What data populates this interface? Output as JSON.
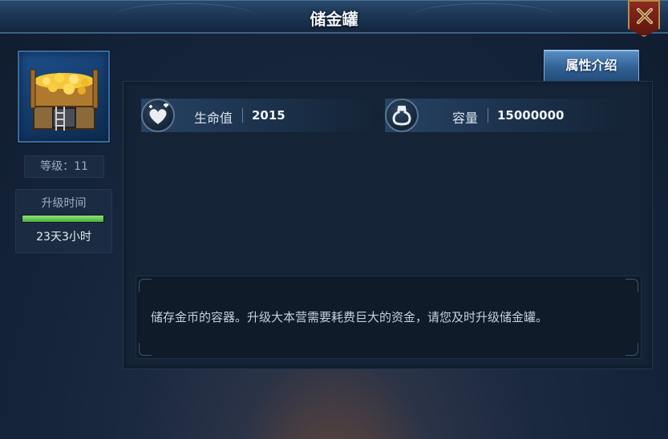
{
  "window": {
    "title": "储金罐"
  },
  "building": {
    "icon": "gold-storage-icon",
    "level_text": "等级：11",
    "upgrade_label": "升级时间",
    "upgrade_progress_percent": 100,
    "upgrade_time": "23天3小时"
  },
  "tabs": {
    "attributes_label": "属性介绍"
  },
  "stats": [
    {
      "icon": "health-heart-icon",
      "name": "生命值",
      "value": "2015"
    },
    {
      "icon": "capacity-jar-icon",
      "name": "容量",
      "value": "15000000"
    }
  ],
  "description": "储存金币的容器。升级大本营需要耗费巨大的资金，请您及时升级储金罐。",
  "colors": {
    "accent_blue": "#2f5f94",
    "progress_green": "#4bb23c",
    "close_red": "#8b2a1e"
  }
}
